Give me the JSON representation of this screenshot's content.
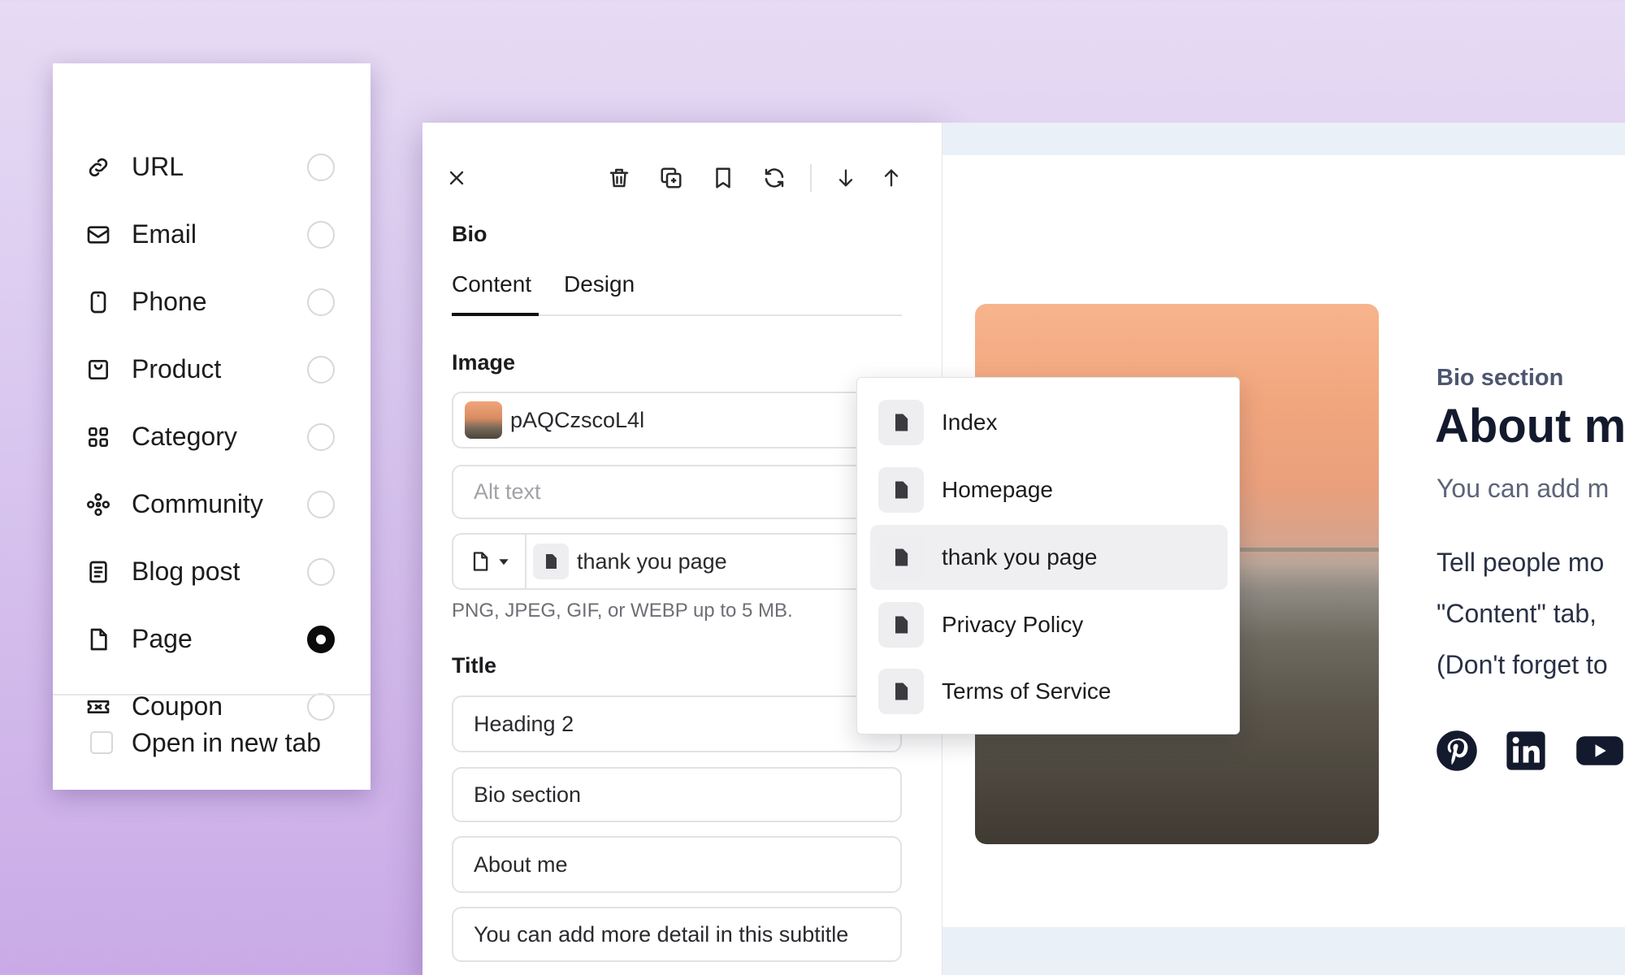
{
  "link_menu": {
    "items": [
      {
        "label": "URL",
        "icon": "link-icon",
        "selected": false
      },
      {
        "label": "Email",
        "icon": "envelope-icon",
        "selected": false
      },
      {
        "label": "Phone",
        "icon": "phone-icon",
        "selected": false
      },
      {
        "label": "Product",
        "icon": "shopping-bag-icon",
        "selected": false
      },
      {
        "label": "Category",
        "icon": "grid-icon",
        "selected": false
      },
      {
        "label": "Community",
        "icon": "community-icon",
        "selected": false
      },
      {
        "label": "Blog post",
        "icon": "document-icon",
        "selected": false
      },
      {
        "label": "Page",
        "icon": "page-icon",
        "selected": true
      },
      {
        "label": "Coupon",
        "icon": "ticket-icon",
        "selected": false
      }
    ],
    "open_in_new_tab": {
      "label": "Open in new tab",
      "checked": false
    }
  },
  "editor": {
    "toolbar": [
      "close-icon",
      "trash-icon",
      "duplicate-icon",
      "bookmark-icon",
      "refresh-icon",
      "arrow-down-icon",
      "arrow-up-icon"
    ],
    "title": "Bio",
    "tabs": [
      {
        "label": "Content",
        "active": true
      },
      {
        "label": "Design",
        "active": false
      }
    ],
    "image": {
      "label": "Image",
      "filename": "pAQCzscoL4l",
      "alt_placeholder": "Alt text",
      "link_value": "thank you page",
      "hint": "PNG, JPEG, GIF, or WEBP up to 5 MB."
    },
    "title_section": {
      "label": "Title",
      "heading_level": "Heading 2",
      "kicker": "Bio section",
      "heading": "About me",
      "subtitle": "You can add more detail in this subtitle"
    }
  },
  "page_picker": {
    "items": [
      "Index",
      "Homepage",
      "thank you page",
      "Privacy Policy",
      "Terms of Service"
    ],
    "selected": "thank you page"
  },
  "preview": {
    "kicker": "Bio section",
    "heading": "About m",
    "subtitle": "You can add m",
    "body_lines": [
      "Tell people mo",
      "\"Content\" tab,",
      "(Don't forget to"
    ],
    "social_icons": [
      "pinterest-icon",
      "linkedin-icon",
      "youtube-icon"
    ]
  },
  "colors": {
    "background_top": "#e6dbf4",
    "background_bottom": "#c9aae6",
    "preview_canvas": "#eaf0f7",
    "heading_navy": "#141a2e",
    "selected_radio": "#0b0b0c"
  }
}
